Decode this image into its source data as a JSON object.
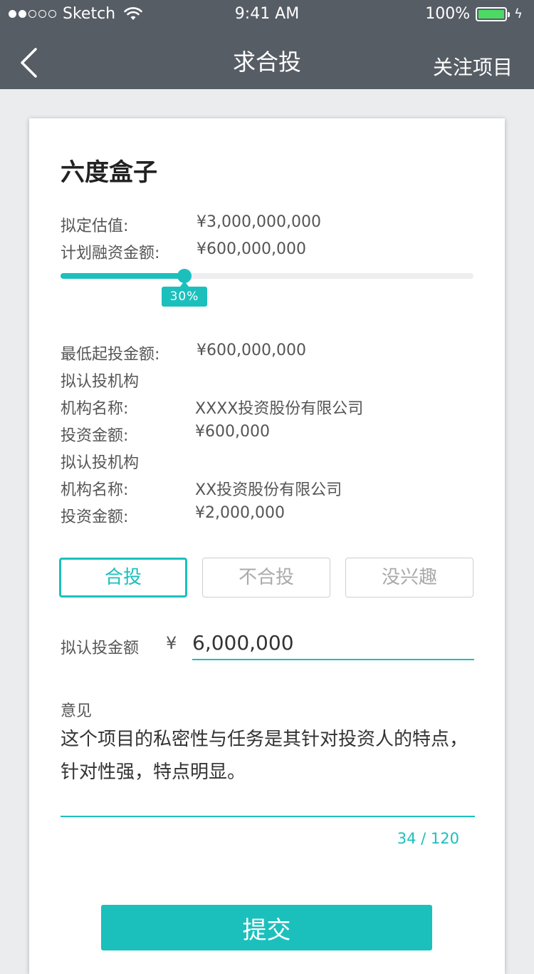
{
  "status_bar": {
    "carrier": "Sketch",
    "time": "9:41 AM",
    "battery": "100%"
  },
  "nav": {
    "title": "求合投",
    "action": "关注项目"
  },
  "project": {
    "title": "六度盒子",
    "valuation_label": "拟定估值:",
    "valuation_value": "¥3,000,000,000",
    "financing_label": "计划融资金额:",
    "financing_value": "¥600,000,000",
    "progress_percent": 30,
    "progress_label": "30%",
    "min_invest_label": "最低起投金额:",
    "min_invest_value": "¥600,000,000",
    "institutions": [
      {
        "header": "拟认投机构",
        "name_label": "机构名称:",
        "name_value": "XXXX投资股份有限公司",
        "amount_label": "投资金额:",
        "amount_value": "¥600,000"
      },
      {
        "header": "拟认投机构",
        "name_label": "机构名称:",
        "name_value": "XX投资股份有限公司",
        "amount_label": "投资金额:",
        "amount_value": "¥2,000,000"
      }
    ]
  },
  "options": {
    "items": [
      "合投",
      "不合投",
      "没兴趣"
    ],
    "selected": "合投"
  },
  "amount": {
    "label": "拟认投金额",
    "currency": "¥",
    "value": "6,000,000"
  },
  "opinion": {
    "label": "意见",
    "text": "这个项目的私密性与任务是其针对投资人的特点，针对性强，特点明显。",
    "counter": "34 / 120"
  },
  "submit_label": "提交",
  "colors": {
    "accent": "#1bc0bd",
    "nav_bg": "#575d65",
    "page_bg": "#ebecee",
    "battery": "#4cd964"
  }
}
